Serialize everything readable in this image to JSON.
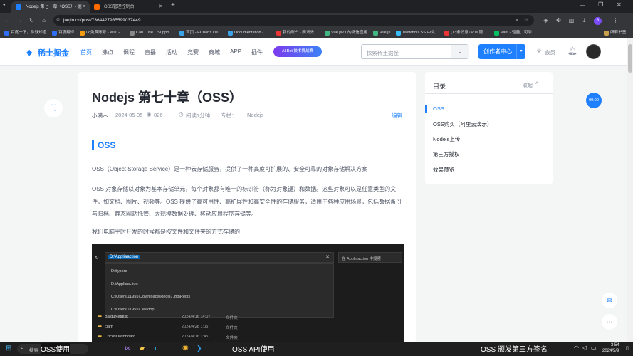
{
  "browser": {
    "tabs": [
      {
        "title": "Nodejs 第七十章（OSS）- 掘",
        "active": true
      },
      {
        "title": "OSS管理控制台",
        "active": false
      }
    ],
    "new_tab": "+",
    "url": "juejin.cn/post/7364427985599037449",
    "bookmarks": [
      "百度一下，你就知道",
      "百度翻译",
      "uc免费账号 - Wiki -...",
      "Can I use... Suppo...",
      "首页 - ECharts De...",
      "Documentation -...",
      "我的账户 - 腾讯先...",
      "Vue.js2.0的微信应用",
      "Vue.js",
      "Tailwind CSS 中文...",
      "(13条消息) Vue 篇...",
      "Vant - 轻量、可靠..."
    ],
    "all_bookmarks": "所有书签",
    "profile": "8"
  },
  "site": {
    "logo": "稀土掘金",
    "nav": [
      "首页",
      "沸点",
      "课程",
      "直播",
      "活动",
      "竞赛",
      "商城",
      "APP",
      "插件"
    ],
    "banner": "AI Bot 技术挑战赛",
    "search_placeholder": "探索稀土掘金",
    "creator_btn": "创作者中心",
    "vip": "会员"
  },
  "article": {
    "title": "Nodejs 第七十章（OSS）",
    "author": "小满zs",
    "date": "2024-05-05",
    "views": "826",
    "read_time": "阅读1分钟",
    "column": "专栏：",
    "column_name": "Nodejs",
    "edit": "编辑",
    "heading": "OSS",
    "p1": "OSS（Object Storage Service）是一种云存储服务，提供了一种高度可扩展的、安全可靠的对象存储解决方案",
    "p2": "OSS 对象存储以对象为基本存储单元，每个对象都有唯一的标识符（称为对象键）和数据。这些对象可以是任意类型的文件，如文档、图片、视频等。OSS 提供了高可用性、高扩展性和高安全性的存储服务，适用于各种应用场景，包括数据备份与归档、静态网站托管、大规模数据处理、移动应用程序存储等。",
    "p3": "我们电脑平时开发的时候都是按文件和文件夹的方式存储的"
  },
  "explorer": {
    "path": "D:\\Appliaaction",
    "search": "在 Appliaaction 中搜索",
    "suggestions": [
      "D:\\typora",
      "D:\\Appliaaction",
      "C:\\Users\\11955\\Downloads\\Redis7.zip\\Redis",
      "C:\\Users\\11955\\Desktop"
    ],
    "files": [
      {
        "name": "BaiduNetdisk",
        "date": "2024/4/16 14:07",
        "type": "文件夹"
      },
      {
        "name": "clam",
        "date": "2024/4/28 1:05",
        "type": "文件夹"
      },
      {
        "name": "CocosDashboard",
        "date": "2024/4/16 1:45",
        "type": "文件夹"
      }
    ]
  },
  "toc": {
    "title": "目录",
    "collapse": "收起",
    "items": [
      "OSS",
      "OSS购买（阿里云演示）",
      "Nodejs上传",
      "第三方授权",
      "效果预览"
    ]
  },
  "float_badge": "00:00",
  "taskbar": {
    "search": "搜索",
    "captions": [
      "OSS使用",
      "OSS API使用",
      "OSS 颁发第三方签名"
    ],
    "time": "3:54",
    "date": "2024/5/9"
  },
  "colors": {
    "accent": "#1e80ff",
    "dark": "#202124"
  }
}
